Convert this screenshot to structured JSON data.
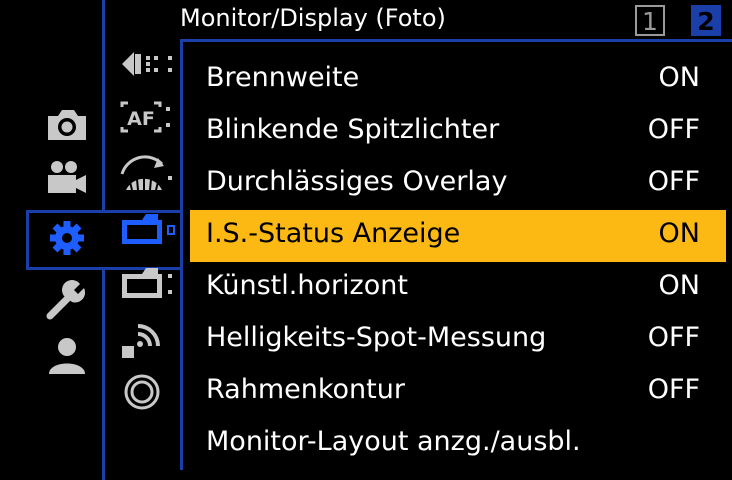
{
  "header": {
    "title": "Monitor/Display (Foto)",
    "pages": [
      "1",
      "2"
    ],
    "active_page": "2"
  },
  "main_categories": [
    {
      "name": "camera-icon"
    },
    {
      "name": "video-camera-icon"
    },
    {
      "name": "gear-icon",
      "selected": true
    },
    {
      "name": "wrench-icon"
    },
    {
      "name": "user-icon"
    }
  ],
  "sub_categories": [
    {
      "name": "focus-tracking-icon"
    },
    {
      "name": "af-icon"
    },
    {
      "name": "exposure-dial-icon"
    },
    {
      "name": "monitor-display-icon",
      "selected": true
    },
    {
      "name": "monitor-display-video-icon"
    },
    {
      "name": "wireless-icon"
    },
    {
      "name": "lens-icon"
    }
  ],
  "menu": {
    "items": [
      {
        "label": "Brennweite",
        "value": "ON"
      },
      {
        "label": "Blinkende Spitzlichter",
        "value": "OFF"
      },
      {
        "label": "Durchlässiges Overlay",
        "value": "OFF"
      },
      {
        "label": "I.S.-Status Anzeige",
        "value": "ON",
        "selected": true
      },
      {
        "label": "Künstl.horizont",
        "value": "ON"
      },
      {
        "label": "Helligkeits-Spot-Messung",
        "value": "OFF"
      },
      {
        "label": "Rahmenkontur",
        "value": "OFF"
      },
      {
        "label": "Monitor-Layout anzg./ausbl.",
        "value": ""
      }
    ]
  },
  "colors": {
    "accent_blue": "#1a3fa8",
    "highlight": "#fdb913",
    "icon_gray": "#c8c8c8"
  }
}
